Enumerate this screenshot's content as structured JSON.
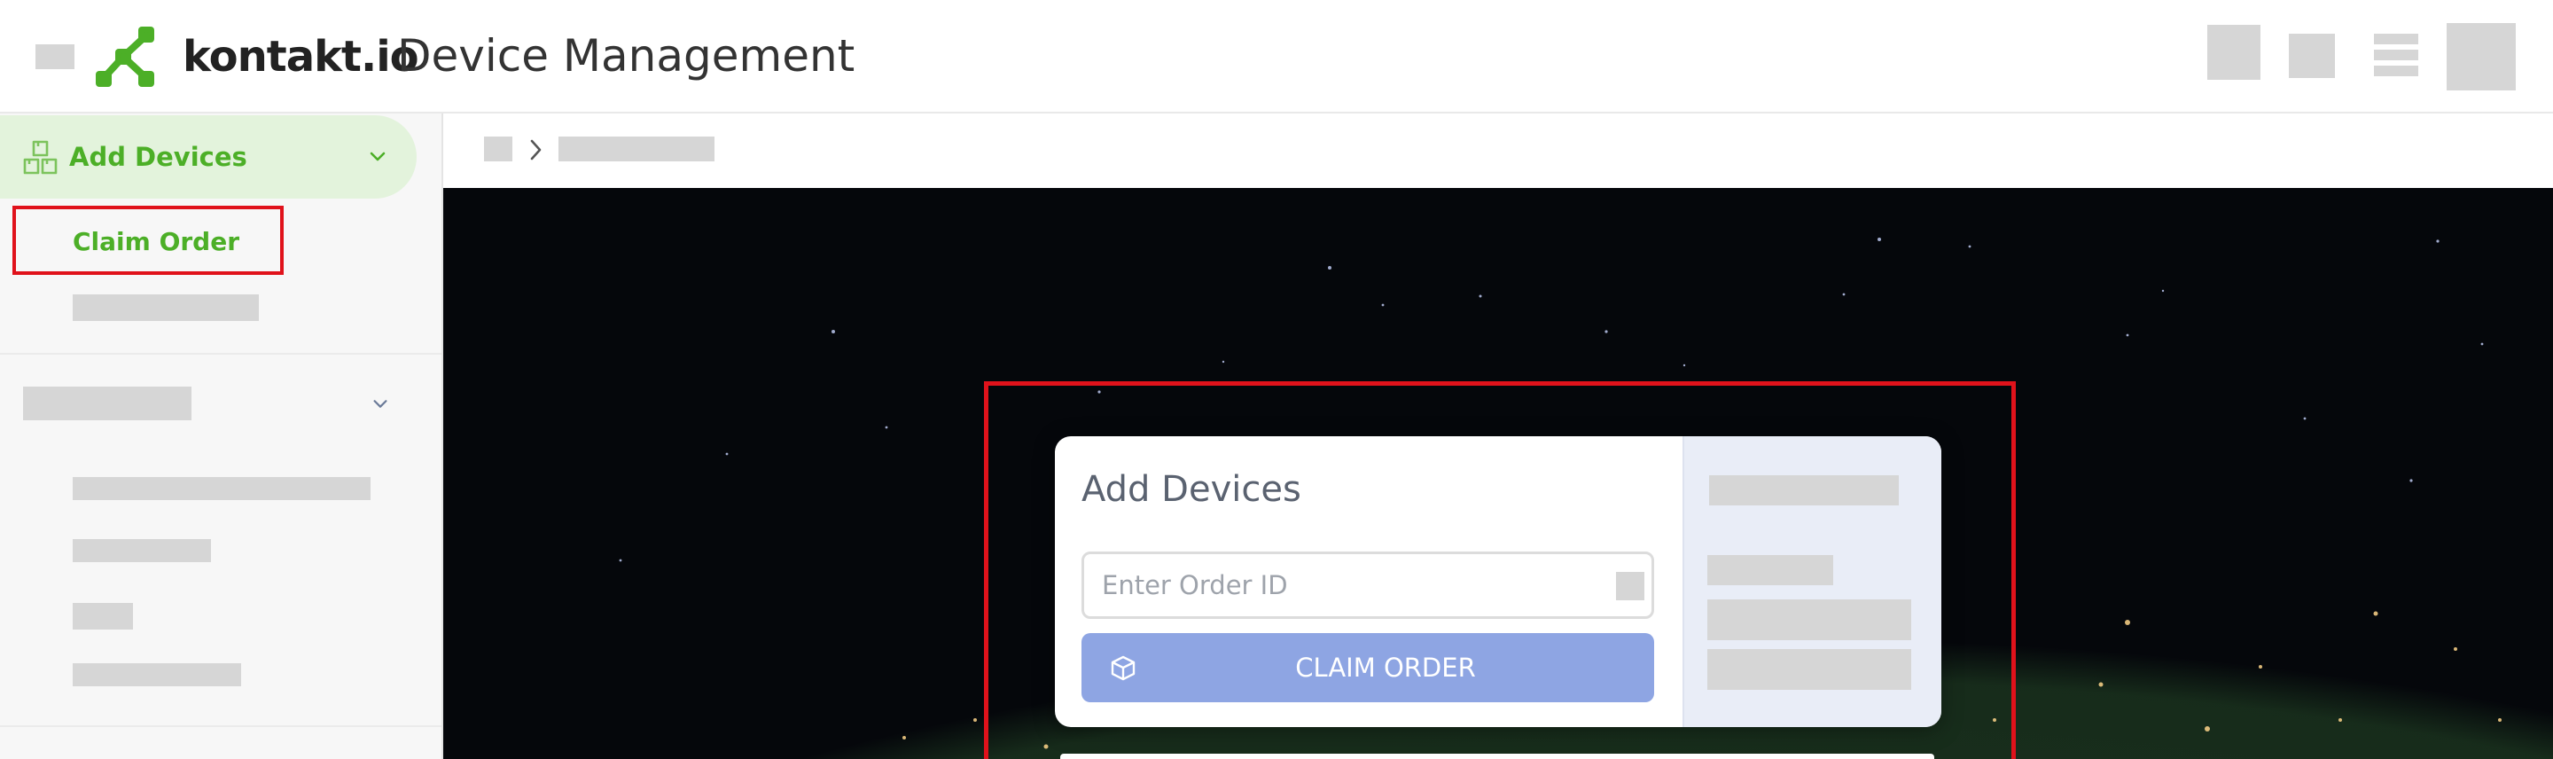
{
  "header": {
    "brand": "kontakt.io",
    "title": "Device Management",
    "logo_color": "#4caf27"
  },
  "sidebar": {
    "section": {
      "label": "Add Devices",
      "icon": "boxes-icon",
      "expanded": true
    },
    "active_item": {
      "label": "Claim Order"
    },
    "accent_color": "#4caf27",
    "active_bg": "#e3f3dc"
  },
  "card": {
    "title": "Add Devices",
    "order_input": {
      "placeholder": "Enter Order ID",
      "value": ""
    },
    "claim_button": {
      "label": "CLAIM ORDER",
      "icon": "box-icon",
      "color": "#8ea5e3"
    }
  },
  "annotations": {
    "highlight_color": "#e0121b"
  }
}
